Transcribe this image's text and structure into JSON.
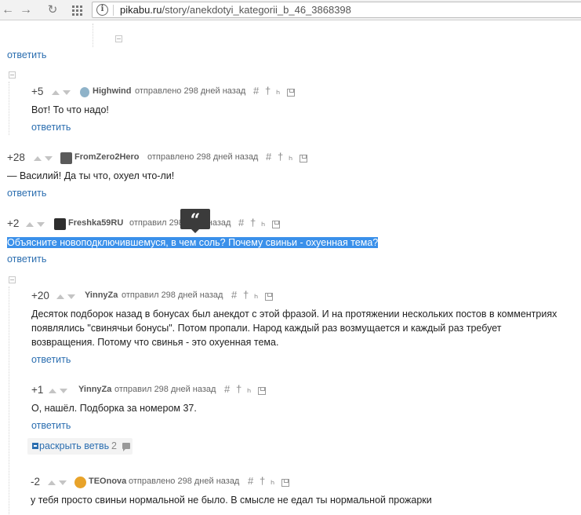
{
  "browser": {
    "url_host": "pikabu.ru",
    "url_path": "/story/anekdotyi_kategorii_b_46_3868398",
    "back_icon": "back-arrow-icon",
    "forward_icon": "forward-arrow-icon",
    "reload_icon": "reload-icon",
    "apps_icon": "apps-grid-icon",
    "page_info_icon": "info-icon",
    "back_glyph": "←",
    "forward_glyph": "→",
    "reload_glyph": "↻",
    "info_glyph": "i"
  },
  "reply_label": "ответить",
  "tooltip_glyph": "“",
  "action_glyphs": {
    "link": "#",
    "up": "†",
    "branch": "ₕ"
  },
  "comments": [
    {
      "score": "+5",
      "user": "Highwind",
      "meta": "отправлено 298 дней назад",
      "text": "Вот! То что надо!",
      "avatar_color": "#8fb3c9"
    },
    {
      "score": "+28",
      "user": "FromZero2Hero",
      "meta": "отправлено 298 дней назад",
      "text": "— Василий! Да ты что, охуел что-ли!",
      "avatar_color": "#5a5a5a"
    },
    {
      "score": "+2",
      "user": "Freshka59RU",
      "meta": "отправил 298 дней назад",
      "text": "Объясните новоподключившемуся, в чем соль? Почему свиньи - охуенная тема?",
      "avatar_color": "#2e2e2e"
    },
    {
      "score": "+20",
      "user": "YinnyZa",
      "meta": "отправил 298 дней назад",
      "text_lines": [
        "Десяток подборок назад в бонусах был анекдот с этой фразой. И на протяжении нескольких постов в комментриях",
        "появлялись \"свинячьи бонусы\". Потом пропали. Народ каждый раз возмущается и каждый раз требует",
        "возвращения. Потому что свинья - это охуенная тема."
      ]
    },
    {
      "score": "+1",
      "user": "YinnyZa",
      "meta": "отправил 298 дней назад",
      "text": "О, нашёл. Подборка за номером 37."
    },
    {
      "score": "-2",
      "user": "TEOnova",
      "meta": "отправлено 298 дней назад",
      "text": "у тебя просто свиньи нормальной не было. В смысле не едал ты нормальной прожарки",
      "avatar_color": "#e8a32a",
      "avatar_label": "nut"
    }
  ],
  "expand_branch": {
    "label": "раскрыть ветвь",
    "count": "2"
  }
}
